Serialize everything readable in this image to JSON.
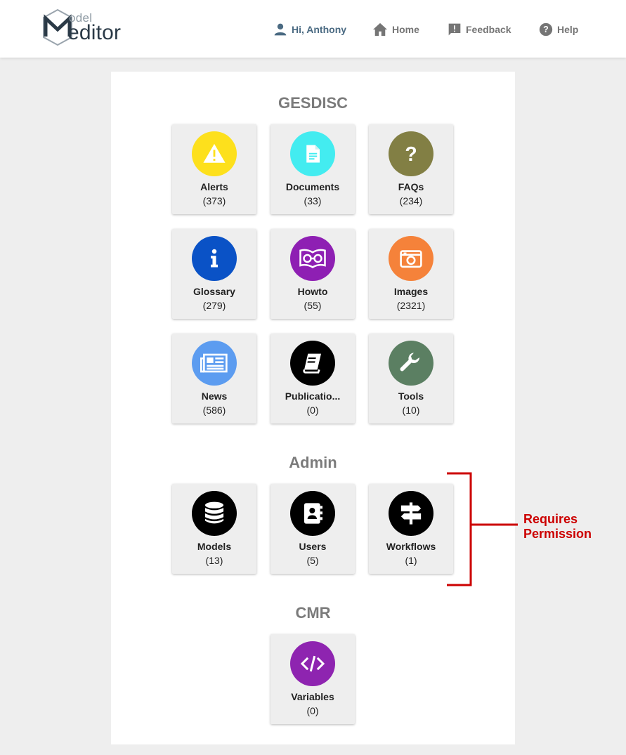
{
  "header": {
    "logo_small": "odel",
    "logo_big": "editor",
    "nav": {
      "greeting": "Hi, Anthony",
      "home": "Home",
      "feedback": "Feedback",
      "help": "Help"
    }
  },
  "sections": {
    "gesdisc": {
      "title": "GESDISC",
      "tiles": [
        {
          "label": "Alerts",
          "count": "(373)",
          "color": "#fde01c",
          "icon": "warning-icon"
        },
        {
          "label": "Documents",
          "count": "(33)",
          "color": "#43ecf0",
          "icon": "document-icon"
        },
        {
          "label": "FAQs",
          "count": "(234)",
          "color": "#827f44",
          "icon": "question-icon"
        },
        {
          "label": "Glossary",
          "count": "(279)",
          "color": "#0a52c6",
          "icon": "info-icon"
        },
        {
          "label": "Howto",
          "count": "(55)",
          "color": "#8e1fb3",
          "icon": "book-glasses-icon"
        },
        {
          "label": "Images",
          "count": "(2321)",
          "color": "#f5823a",
          "icon": "camera-icon"
        },
        {
          "label": "News",
          "count": "(586)",
          "color": "#5c9cf0",
          "icon": "newspaper-icon"
        },
        {
          "label": "Publicatio...",
          "count": "(0)",
          "color": "#000000",
          "icon": "publication-icon"
        },
        {
          "label": "Tools",
          "count": "(10)",
          "color": "#5b7f62",
          "icon": "wrench-icon"
        }
      ]
    },
    "admin": {
      "title": "Admin",
      "tiles": [
        {
          "label": "Models",
          "count": "(13)",
          "color": "#000000",
          "icon": "database-icon"
        },
        {
          "label": "Users",
          "count": "(5)",
          "color": "#000000",
          "icon": "contacts-icon"
        },
        {
          "label": "Workflows",
          "count": "(1)",
          "color": "#000000",
          "icon": "signpost-icon"
        }
      ]
    },
    "cmr": {
      "title": "CMR",
      "tiles": [
        {
          "label": "Variables",
          "count": "(0)",
          "color": "#8e24b0",
          "icon": "code-icon"
        }
      ]
    }
  },
  "annotation": {
    "line1": "Requires",
    "line2": "Permission",
    "color": "#cc0000"
  }
}
